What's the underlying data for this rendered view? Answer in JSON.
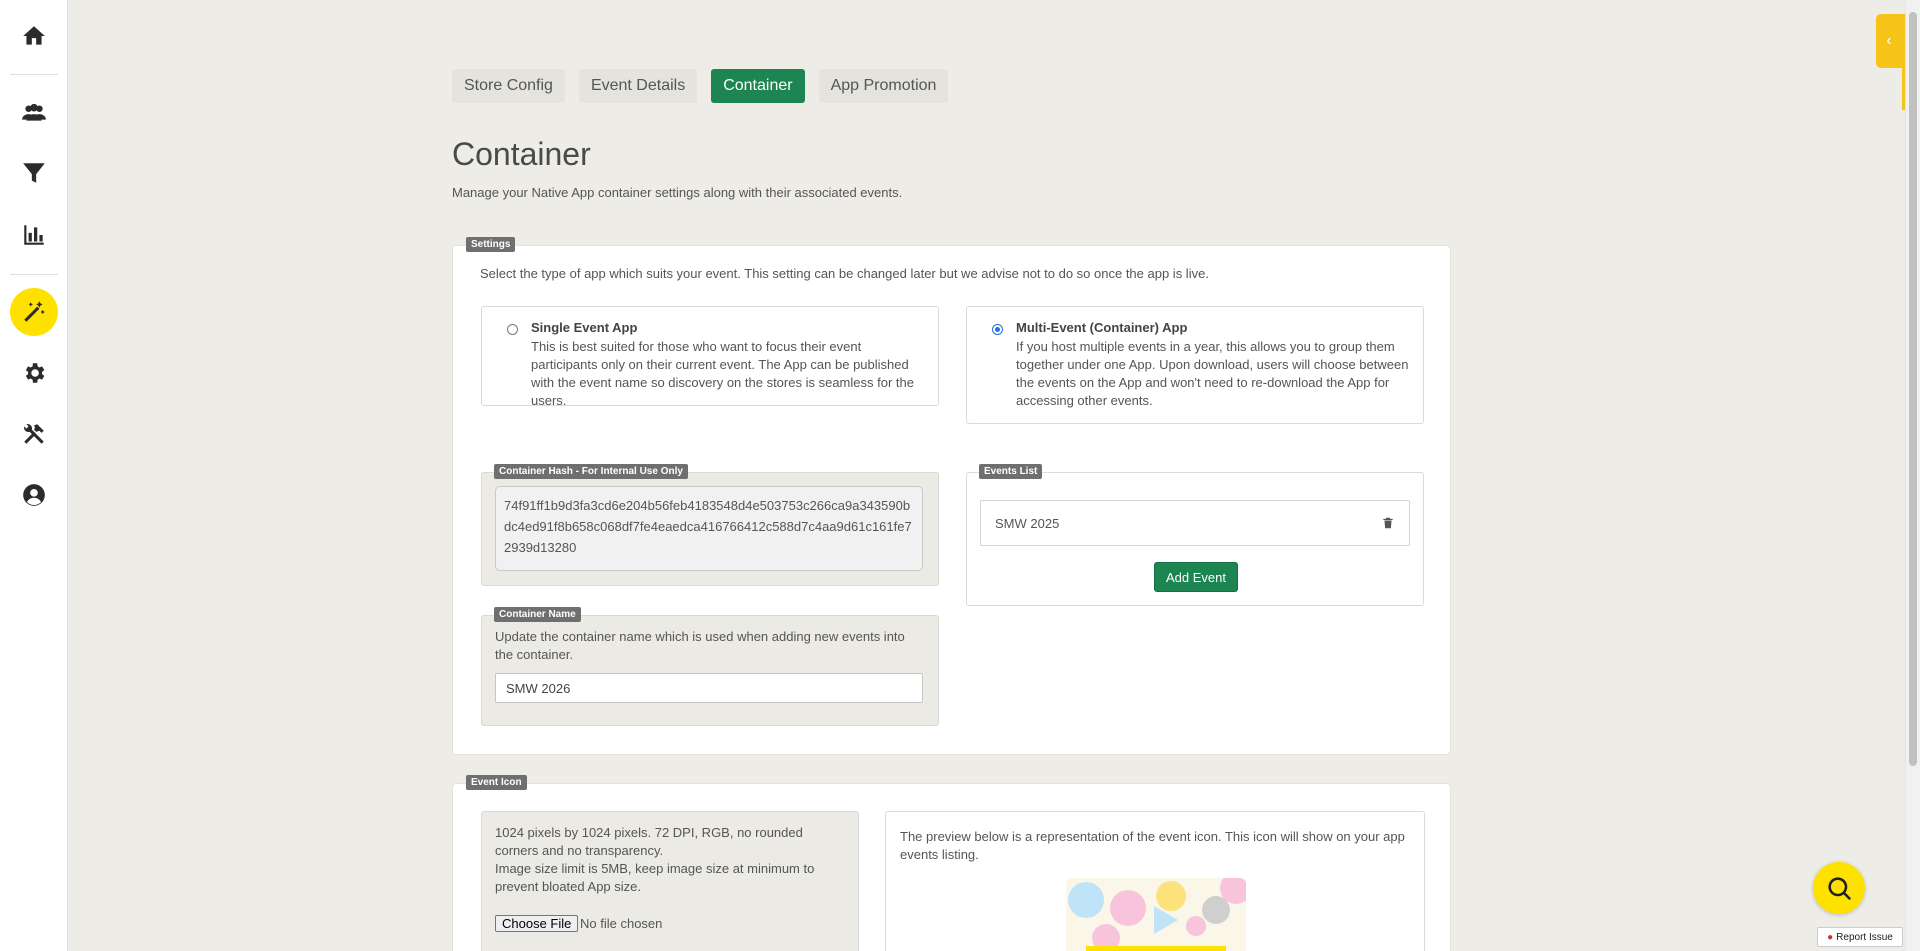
{
  "tabs": [
    {
      "label": "Store Config",
      "active": false
    },
    {
      "label": "Event Details",
      "active": false
    },
    {
      "label": "Container",
      "active": true
    },
    {
      "label": "App Promotion",
      "active": false
    }
  ],
  "page": {
    "title": "Container",
    "subtitle": "Manage your Native App container settings along with their associated events."
  },
  "settings": {
    "legend": "Settings",
    "description": "Select the type of app which suits your event. This setting can be changed later but we advise not to do so once the app is live.",
    "single": {
      "title": "Single Event App",
      "description": "This is best suited for those who want to focus their event participants only on their current event. The App can be published with the event name so discovery on the stores is seamless for the users.",
      "selected": false
    },
    "multi": {
      "title": "Multi-Event (Container) App",
      "description": "If you host multiple events in a year, this allows you to group them together under one App. Upon download, users will choose between the events on the App and won't need to re-download the App for accessing other events.",
      "selected": true
    }
  },
  "container_hash": {
    "legend": "Container Hash - For Internal Use Only",
    "value": "74f91ff1b9d3fa3cd6e204b56feb4183548d4e503753c266ca9a343590bdc4ed91f8b658c068df7fe4eaedca416766412c588d7c4aa9d61c161fe72939d13280"
  },
  "container_name": {
    "legend": "Container Name",
    "description": "Update the container name which is used when adding new events into the container.",
    "value": "SMW 2026"
  },
  "events_list": {
    "legend": "Events List",
    "items": [
      "SMW 2025"
    ],
    "add_label": "Add Event"
  },
  "event_icon": {
    "legend": "Event Icon",
    "requirements": "1024 pixels by 1024 pixels. 72 DPI, RGB, no rounded corners and no transparency.\nImage size limit is 5MB, keep image size at minimum to prevent bloated App size.",
    "choose_file_label": "Choose File",
    "no_file_label": "No file chosen",
    "preview_description": "The preview below is a representation of the event icon. This icon will show on your app events listing."
  },
  "report_issue_label": "Report Issue",
  "colors": {
    "accent_green": "#1c8551",
    "accent_yellow": "#ffe100",
    "background": "#edece6"
  },
  "icons": {
    "sidebar": [
      "home-icon",
      "users-icon",
      "filter-icon",
      "bar-chart-icon",
      "magic-wand-icon",
      "gear-icon",
      "tools-icon",
      "account-icon"
    ],
    "help": "search-icon",
    "delete": "trash-icon"
  }
}
